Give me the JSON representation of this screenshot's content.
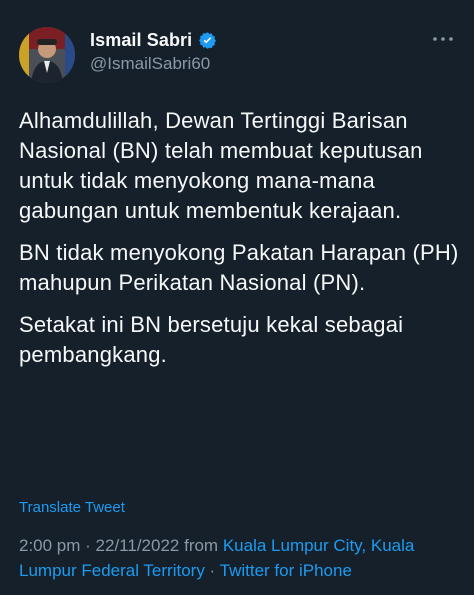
{
  "author": {
    "display_name": "Ismail Sabri",
    "handle": "@IsmailSabri60",
    "verified": true,
    "avatar_icon": "profile-photo"
  },
  "tweet": {
    "paragraphs": [
      "Alhamdulillah, Dewan Tertinggi Barisan Nasional (BN) telah membuat keputusan untuk tidak menyokong mana-mana gabungan untuk membentuk kerajaan.",
      "BN tidak menyokong Pakatan Harapan (PH) mahupun Perikatan Nasional (PN).",
      "Setakat ini BN bersetuju kekal sebagai pembangkang."
    ],
    "translate_label": "Translate Tweet"
  },
  "meta": {
    "time": "2:00 pm",
    "sep1": " · ",
    "date": "22/11/2022",
    "from_word": " from ",
    "location": "Kuala Lumpur City, Kuala Lumpur Federal Territory",
    "sep2": " · ",
    "source": "Twitter for iPhone"
  },
  "colors": {
    "background": "#15202b",
    "text": "#f7f9f9",
    "secondary": "#8b98a5",
    "link": "#1d9bf0"
  }
}
